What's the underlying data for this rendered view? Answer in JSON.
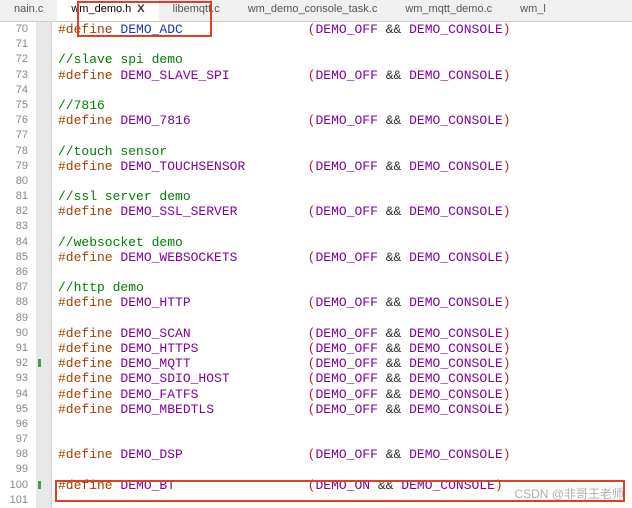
{
  "tabs": {
    "t0": "nain.c",
    "t1": "wm_demo.h",
    "t2": "libemqtt.c",
    "t3": "wm_demo_console_task.c",
    "t4": "wm_mqtt_demo.c",
    "t5": "wm_l",
    "close": "X"
  },
  "lineNumbers": [
    "70",
    "71",
    "72",
    "73",
    "74",
    "75",
    "76",
    "77",
    "78",
    "79",
    "80",
    "81",
    "82",
    "83",
    "84",
    "85",
    "86",
    "87",
    "88",
    "89",
    "90",
    "91",
    "92",
    "93",
    "94",
    "95",
    "96",
    "97",
    "98",
    "99",
    "100",
    "101"
  ],
  "tokens": {
    "define": "#define",
    "pOpen": "(",
    "pClose": ")",
    "amp": " && ",
    "demoOff": "DEMO_OFF",
    "demoOn": "DEMO_ON",
    "demoConsole": "DEMO_CONSOLE",
    "cmt_slave": "//slave spi demo",
    "cmt_7816": "//7816",
    "cmt_touch": "//touch sensor",
    "cmt_ssl": "//ssl server demo",
    "cmt_ws": "//websocket demo",
    "cmt_http": "//http demo",
    "m_adc": "DEMO_ADC",
    "m_slave_spi": "DEMO_SLAVE_SPI",
    "m_7816": "DEMO_7816",
    "m_touchsensor": "DEMO_TOUCHSENSOR",
    "m_ssl_server": "DEMO_SSL_SERVER",
    "m_websockets": "DEMO_WEBSOCKETS",
    "m_http": "DEMO_HTTP",
    "m_scan": "DEMO_SCAN",
    "m_https": "DEMO_HTTPS",
    "m_mqtt": "DEMO_MQTT",
    "m_sdio_host": "DEMO_SDIO_HOST",
    "m_fatfs": "DEMO_FATFS",
    "m_mbedtls": "DEMO_MBEDTLS",
    "m_dsp": "DEMO_DSP",
    "m_bt": "DEMO_BT"
  },
  "colWidth1": 32,
  "watermark": "CSDN @非哥王老师"
}
